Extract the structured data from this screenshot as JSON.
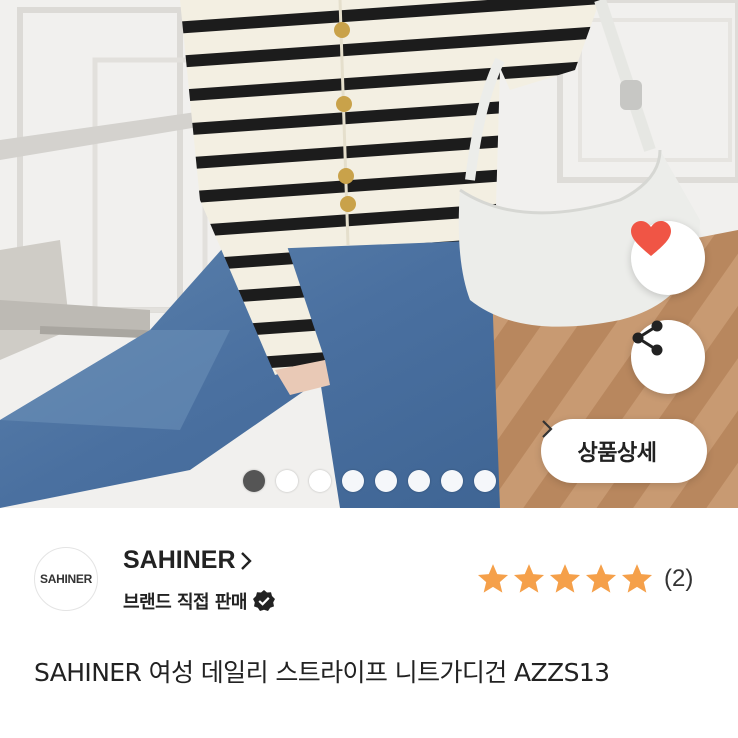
{
  "product_image": {
    "detail_button": {
      "label": "상품상세"
    },
    "carousel": {
      "total": 8,
      "active_index": 0
    },
    "icons": {
      "favorite": "heart-icon",
      "share": "share-icon",
      "detail_arrow": "chevron-right-icon"
    },
    "colors": {
      "heart": "#f05545"
    }
  },
  "seller": {
    "logo_text": "SAHINER",
    "name": "SAHINER",
    "direct_sale_label": "브랜드 직접 판매",
    "icons": {
      "name_arrow": "chevron-right-icon",
      "verified": "verified-badge-icon"
    }
  },
  "rating": {
    "stars": 5,
    "review_count": "(2)",
    "colors": {
      "star": "#f5a04a"
    }
  },
  "product": {
    "title": "SAHINER 여성 데일리 스트라이프 니트가디건 AZZS13"
  }
}
